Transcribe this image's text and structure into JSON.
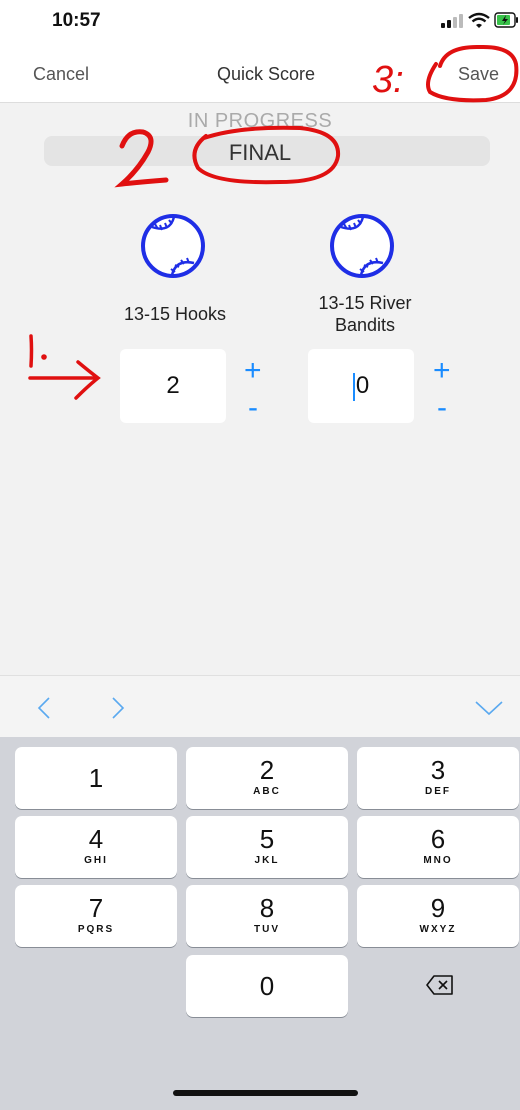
{
  "status": {
    "time": "10:57"
  },
  "nav": {
    "cancel": "Cancel",
    "title": "Quick Score",
    "save": "Save"
  },
  "status_selector": {
    "options": [
      "IN PROGRESS",
      "FINAL"
    ],
    "selected": "FINAL"
  },
  "teams": [
    {
      "name": "13-15 Hooks",
      "score": "2",
      "plus": "+",
      "minus": "-"
    },
    {
      "name_line1": "13-15 River",
      "name_line2": "Bandits",
      "score": "0",
      "plus": "+",
      "minus": "-"
    }
  ],
  "accessory": {
    "prev": "<",
    "next": ">",
    "done": "∨"
  },
  "keypad": {
    "keys": [
      {
        "num": "1",
        "letters": ""
      },
      {
        "num": "2",
        "letters": "ABC"
      },
      {
        "num": "3",
        "letters": "DEF"
      },
      {
        "num": "4",
        "letters": "GHI"
      },
      {
        "num": "5",
        "letters": "JKL"
      },
      {
        "num": "6",
        "letters": "MNO"
      },
      {
        "num": "7",
        "letters": "PQRS"
      },
      {
        "num": "8",
        "letters": "TUV"
      },
      {
        "num": "9",
        "letters": "WXYZ"
      },
      {
        "num": "0",
        "letters": ""
      }
    ],
    "delete_icon": "backspace-icon"
  },
  "annotations": {
    "one": "1.",
    "two": "2",
    "three": "3:"
  },
  "colors": {
    "accent": "#1a8cff",
    "baseball": "#1f2ee6",
    "annotation": "#e01010"
  }
}
